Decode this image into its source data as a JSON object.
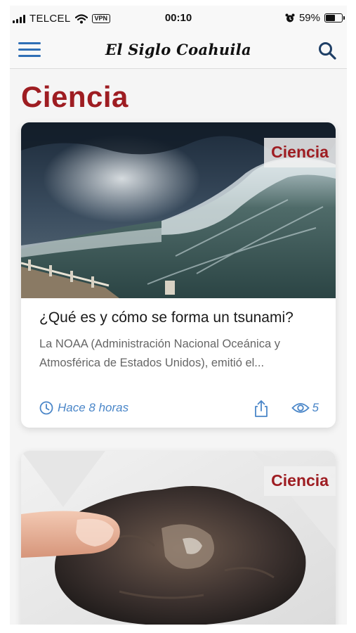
{
  "status_bar": {
    "carrier": "TELCEL",
    "vpn": "VPN",
    "time": "00:10",
    "battery": "59%",
    "battery_level": 0.59
  },
  "nav": {
    "brand": "El Siglo Coahuila",
    "menu_icon": "hamburger-menu-icon",
    "search_icon": "search-icon"
  },
  "page": {
    "title": "Ciencia"
  },
  "articles": [
    {
      "category": "Ciencia",
      "image": "tsunami-wave-image",
      "title": "¿Qué es y cómo se forma un tsunami?",
      "excerpt": "La NOAA (Administración Nacional Oceánica y Atmosférica de Estados Unidos), emitió el...",
      "time": "Hace 8 horas",
      "views": "5"
    },
    {
      "category": "Ciencia",
      "image": "meteorite-rock-image"
    }
  ],
  "colors": {
    "accent_red": "#9e1d22",
    "link_blue": "#4a86c8",
    "menu_blue": "#2f6fb5"
  }
}
